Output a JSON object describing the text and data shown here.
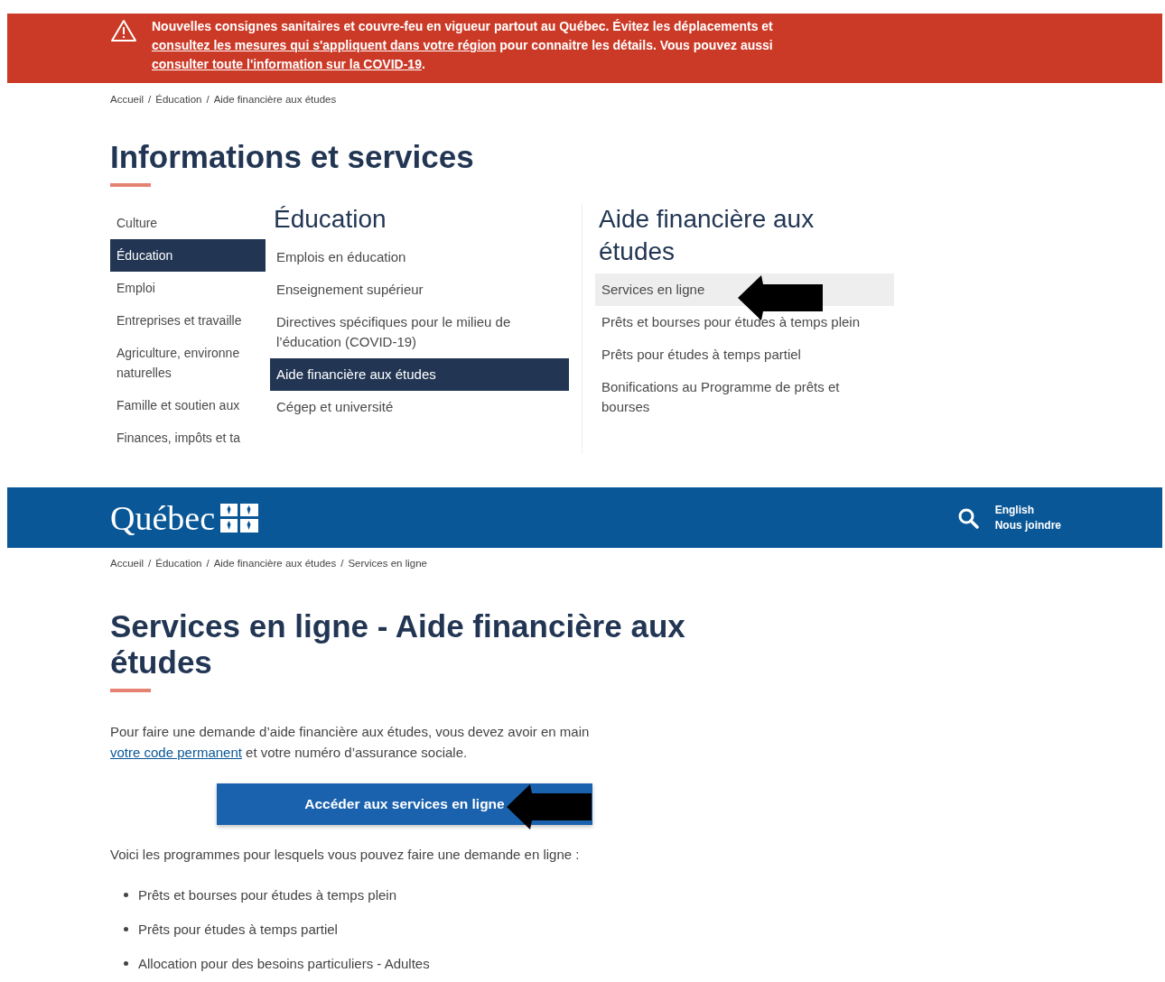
{
  "first_page": {
    "alert": {
      "segments": [
        {
          "kind": "text",
          "text": "Nouvelles consignes sanitaires et couvre-feu en vigueur partout au Québec. Évitez les déplacements et "
        },
        {
          "kind": "link",
          "text": "consultez les mesures qui s'appliquent dans votre région"
        },
        {
          "kind": "text",
          "text": " pour connaitre les détails. Vous pouvez aussi "
        },
        {
          "kind": "link",
          "text": "consulter toute l'information sur la COVID-19"
        },
        {
          "kind": "text",
          "text": "."
        }
      ]
    },
    "breadcrumb": {
      "separator": "/",
      "items": [
        "Accueil",
        "Éducation",
        "Aide financière aux études"
      ]
    },
    "title": "Informations et services",
    "columns": [
      {
        "items": [
          {
            "label": "Culture",
            "selected": false
          },
          {
            "label": "Éducation",
            "selected": true
          },
          {
            "label": "Emploi",
            "selected": false
          },
          {
            "label": "Entreprises et travaille",
            "selected": false
          },
          {
            "label": "Agriculture, environne naturelles",
            "selected": false
          },
          {
            "label": "Famille et soutien aux",
            "selected": false
          },
          {
            "label": "Finances, impôts et ta",
            "selected": false
          }
        ]
      },
      {
        "title": "Éducation",
        "items": [
          {
            "label": "Emplois en éducation",
            "selected": false
          },
          {
            "label": "Enseignement supérieur",
            "selected": false
          },
          {
            "label": "Directives spécifiques pour le milieu de l’éducation (COVID-19)",
            "selected": false
          },
          {
            "label": "Aide financière aux études",
            "selected": true
          },
          {
            "label": "Cégep et université",
            "selected": false
          }
        ]
      },
      {
        "title": "Aide financière aux études",
        "items": [
          {
            "label": "Services en ligne",
            "selected": true
          },
          {
            "label": "Prêts et bourses pour études à temps plein",
            "selected": false
          },
          {
            "label": "Prêts pour études à temps partiel",
            "selected": false
          },
          {
            "label": "Bonifications au Programme de prêts et bourses",
            "selected": false
          }
        ]
      }
    ]
  },
  "second_page": {
    "header": {
      "logo": "Québec",
      "links": [
        "English",
        "Nous joindre"
      ]
    },
    "breadcrumb": {
      "separator": "/",
      "items": [
        "Accueil",
        "Éducation",
        "Aide financière aux études",
        "Services en ligne"
      ]
    },
    "title": "Services en ligne - Aide financière aux études",
    "paragraph": [
      {
        "kind": "text",
        "text": "Pour faire une demande d’aide financière aux études, vous devez avoir en main "
      },
      {
        "kind": "link",
        "text": "votre code permanent"
      },
      {
        "kind": "text",
        "text": " et votre numéro d’assurance sociale."
      }
    ],
    "button": "Accéder aux services en ligne",
    "intro": "Voici les programmes pour lesquels vous pouvez faire une demande en ligne :",
    "programs": [
      "Prêts et bourses pour études à temps plein",
      "Prêts pour études à temps partiel",
      "Allocation pour des besoins particuliers - Adultes"
    ]
  }
}
